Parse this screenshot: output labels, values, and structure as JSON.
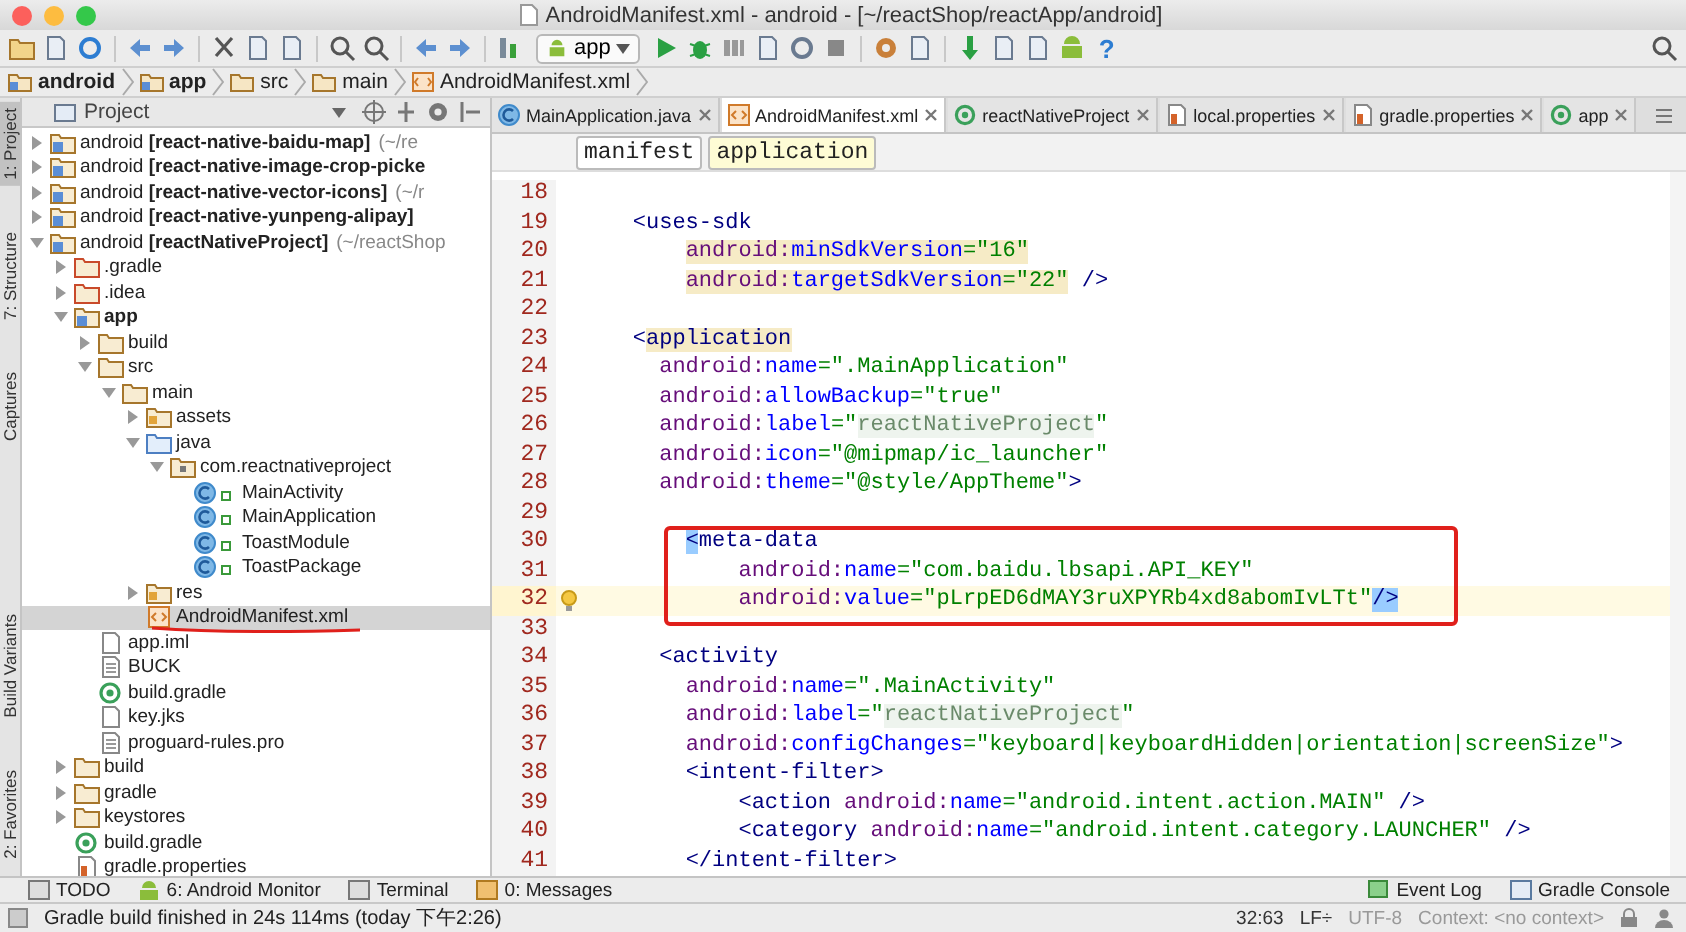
{
  "window": {
    "title": "AndroidManifest.xml - android - [~/reactShop/reactApp/android]"
  },
  "toolbar": {
    "run_config": "app",
    "help": "?"
  },
  "nav": [
    {
      "label": "android",
      "kind": "module"
    },
    {
      "label": "app",
      "kind": "module"
    },
    {
      "label": "src",
      "kind": "folder"
    },
    {
      "label": "main",
      "kind": "folder"
    },
    {
      "label": "AndroidManifest.xml",
      "kind": "manifest"
    }
  ],
  "left_strip": {
    "top": [
      {
        "label": "1: Project",
        "selected": true
      },
      {
        "label": "7: Structure",
        "selected": false
      },
      {
        "label": "Captures",
        "selected": false
      }
    ],
    "bottom": [
      {
        "label": "Build Variants",
        "selected": false
      },
      {
        "label": "2: Favorites",
        "selected": false
      }
    ]
  },
  "project": {
    "view": "Project",
    "tree": [
      {
        "label": "android **[react-native-baidu-map]**",
        "suffix": "(~/re",
        "kind": "module",
        "expanded": false,
        "selected": false,
        "underlined": false
      },
      {
        "label": "android **[react-native-image-crop-picke**",
        "kind": "module",
        "expanded": false,
        "selected": false,
        "underlined": false
      },
      {
        "label": "android **[react-native-vector-icons]**",
        "suffix": "(~/r",
        "kind": "module",
        "expanded": false,
        "selected": false,
        "underlined": false
      },
      {
        "label": "android **[react-native-yunpeng-alipay]**",
        "kind": "module",
        "expanded": false,
        "selected": false,
        "underlined": false
      },
      {
        "label": "android **[reactNativeProject]**",
        "suffix": "(~/reactShop",
        "kind": "module",
        "expanded": true,
        "selected": false,
        "underlined": false,
        "children": [
          {
            "label": ".gradle",
            "kind": "folder",
            "expanded": false,
            "selected": false,
            "underlined": false
          },
          {
            "label": ".idea",
            "kind": "folder",
            "expanded": false,
            "selected": false,
            "underlined": false
          },
          {
            "label": "**app**",
            "kind": "module",
            "expanded": true,
            "selected": false,
            "underlined": false,
            "children": [
              {
                "label": "build",
                "kind": "folder",
                "expanded": false,
                "selected": false,
                "underlined": false
              },
              {
                "label": "src",
                "kind": "folder",
                "expanded": true,
                "selected": false,
                "underlined": false,
                "children": [
                  {
                    "label": "main",
                    "kind": "folder",
                    "expanded": true,
                    "selected": false,
                    "underlined": false,
                    "children": [
                      {
                        "label": "assets",
                        "kind": "resfolder",
                        "expanded": false,
                        "selected": false,
                        "underlined": false
                      },
                      {
                        "label": "java",
                        "kind": "source",
                        "expanded": true,
                        "selected": false,
                        "underlined": false,
                        "children": [
                          {
                            "label": "com.reactnativeproject",
                            "kind": "package",
                            "expanded": true,
                            "selected": false,
                            "underlined": false,
                            "children": [
                              {
                                "label": "MainActivity",
                                "kind": "class",
                                "selected": false,
                                "underlined": false
                              },
                              {
                                "label": "MainApplication",
                                "kind": "class",
                                "selected": false,
                                "underlined": false
                              },
                              {
                                "label": "ToastModule",
                                "kind": "class",
                                "selected": false,
                                "underlined": false
                              },
                              {
                                "label": "ToastPackage",
                                "kind": "class",
                                "selected": false,
                                "underlined": false
                              }
                            ]
                          }
                        ]
                      },
                      {
                        "label": "res",
                        "kind": "resfolder",
                        "expanded": false,
                        "selected": false,
                        "underlined": false
                      },
                      {
                        "label": "AndroidManifest.xml",
                        "kind": "manifest",
                        "selected": true,
                        "underlined": true
                      }
                    ]
                  }
                ]
              },
              {
                "label": "app.iml",
                "kind": "file",
                "selected": false,
                "underlined": false
              },
              {
                "label": "BUCK",
                "kind": "text",
                "selected": false,
                "underlined": false
              },
              {
                "label": "build.gradle",
                "kind": "gradle",
                "selected": false,
                "underlined": false
              },
              {
                "label": "key.jks",
                "kind": "file",
                "selected": false,
                "underlined": false
              },
              {
                "label": "proguard-rules.pro",
                "kind": "text",
                "selected": false,
                "underlined": false
              }
            ]
          },
          {
            "label": "build",
            "kind": "folder",
            "expanded": false,
            "selected": false,
            "underlined": false
          },
          {
            "label": "gradle",
            "kind": "folder",
            "expanded": false,
            "selected": false,
            "underlined": false
          },
          {
            "label": "keystores",
            "kind": "folder",
            "expanded": false,
            "selected": false,
            "underlined": false
          },
          {
            "label": "build.gradle",
            "kind": "gradle",
            "selected": false,
            "underlined": false
          },
          {
            "label": "gradle.properties",
            "kind": "properties",
            "selected": false,
            "underlined": false
          }
        ]
      }
    ]
  },
  "tabs": [
    {
      "label": "MainApplication.java",
      "kind": "class",
      "selected": false
    },
    {
      "label": "AndroidManifest.xml",
      "kind": "manifest",
      "selected": true
    },
    {
      "label": "reactNativeProject",
      "kind": "gradle",
      "selected": false
    },
    {
      "label": "local.properties",
      "kind": "properties",
      "selected": false
    },
    {
      "label": "gradle.properties",
      "kind": "properties",
      "selected": false
    },
    {
      "label": "app",
      "kind": "gradle",
      "selected": false
    }
  ],
  "breadcrumb": [
    {
      "label": "manifest",
      "selected": false
    },
    {
      "label": "application",
      "selected": true
    }
  ],
  "code": {
    "lines": [
      {
        "n": "18",
        "current": false,
        "boxed": false
      },
      {
        "n": "19",
        "current": false,
        "boxed": false,
        "tokens": [
          {
            "kind": "tag",
            "text": "    <uses-sdk"
          }
        ]
      },
      {
        "n": "20",
        "current": false,
        "boxed": false,
        "tokens": [
          {
            "kind": "ns",
            "text": "        android:",
            "highlighted": true
          },
          {
            "kind": "attr",
            "text": "minSdkVersion",
            "highlighted": true
          },
          {
            "kind": "value",
            "text": "=\"16\"",
            "highlighted": true
          }
        ]
      },
      {
        "n": "21",
        "current": false,
        "boxed": false,
        "tokens": [
          {
            "kind": "ns",
            "text": "        android:",
            "highlighted": true
          },
          {
            "kind": "attr",
            "text": "targetSdkVersion",
            "highlighted": true
          },
          {
            "kind": "value",
            "text": "=\"22\"",
            "highlighted": true
          },
          {
            "kind": "tag",
            "text": " />",
            "highlighted": false
          }
        ]
      },
      {
        "n": "22",
        "current": false,
        "boxed": false
      },
      {
        "n": "23",
        "current": false,
        "boxed": false,
        "tokens": [
          {
            "kind": "tag",
            "text": "    <",
            "highlighted": false
          },
          {
            "kind": "tag",
            "text": "application",
            "highlighted": true
          }
        ]
      },
      {
        "n": "24",
        "current": false,
        "boxed": false,
        "tokens": [
          {
            "kind": "ns",
            "text": "      android:"
          },
          {
            "kind": "attr",
            "text": "name"
          },
          {
            "kind": "value",
            "text": "=\".MainApplication\""
          }
        ]
      },
      {
        "n": "25",
        "current": false,
        "boxed": false,
        "tokens": [
          {
            "kind": "ns",
            "text": "      android:"
          },
          {
            "kind": "attr",
            "text": "allowBackup"
          },
          {
            "kind": "value",
            "text": "=\"true\""
          }
        ]
      },
      {
        "n": "26",
        "current": false,
        "boxed": false,
        "tokens": [
          {
            "kind": "ns",
            "text": "      android:"
          },
          {
            "kind": "attr",
            "text": "label"
          },
          {
            "kind": "value",
            "text": "=\""
          },
          {
            "kind": "folded",
            "text": "reactNativeProject"
          },
          {
            "kind": "value",
            "text": "\""
          }
        ]
      },
      {
        "n": "27",
        "current": false,
        "boxed": false,
        "tokens": [
          {
            "kind": "ns",
            "text": "      android:"
          },
          {
            "kind": "attr",
            "text": "icon"
          },
          {
            "kind": "value",
            "text": "=\"@mipmap/ic_launcher\""
          }
        ]
      },
      {
        "n": "28",
        "current": false,
        "boxed": false,
        "tokens": [
          {
            "kind": "ns",
            "text": "      android:"
          },
          {
            "kind": "attr",
            "text": "theme"
          },
          {
            "kind": "value",
            "text": "=\"@style/AppTheme\""
          },
          {
            "kind": "tag",
            "text": ">"
          }
        ]
      },
      {
        "n": "29",
        "current": false,
        "boxed": false
      },
      {
        "n": "30",
        "current": false,
        "boxed": true,
        "tokens": [
          {
            "kind": "brace",
            "text": "        <"
          },
          {
            "kind": "tag",
            "text": "meta-data"
          }
        ]
      },
      {
        "n": "31",
        "current": false,
        "boxed": true,
        "tokens": [
          {
            "kind": "ns",
            "text": "            android:"
          },
          {
            "kind": "attr",
            "text": "name"
          },
          {
            "kind": "value",
            "text": "=\"com.baidu.lbsapi.API_KEY\""
          }
        ]
      },
      {
        "n": "32",
        "current": true,
        "boxed": true,
        "tokens": [
          {
            "kind": "ns",
            "text": "            android:"
          },
          {
            "kind": "attr",
            "text": "value"
          },
          {
            "kind": "value",
            "text": "=\"pLrpED6dMAY3ruXPYRb4xd8abomIvLTt\""
          },
          {
            "kind": "brace",
            "text": "/>"
          }
        ]
      },
      {
        "n": "33",
        "current": false,
        "boxed": false
      },
      {
        "n": "34",
        "current": false,
        "boxed": false,
        "tokens": [
          {
            "kind": "tag",
            "text": "      <activity"
          }
        ]
      },
      {
        "n": "35",
        "current": false,
        "boxed": false,
        "tokens": [
          {
            "kind": "ns",
            "text": "        android:"
          },
          {
            "kind": "attr",
            "text": "name"
          },
          {
            "kind": "value",
            "text": "=\".MainActivity\""
          }
        ]
      },
      {
        "n": "36",
        "current": false,
        "boxed": false,
        "tokens": [
          {
            "kind": "ns",
            "text": "        android:"
          },
          {
            "kind": "attr",
            "text": "label"
          },
          {
            "kind": "value",
            "text": "=\""
          },
          {
            "kind": "folded",
            "text": "reactNativeProject"
          },
          {
            "kind": "value",
            "text": "\""
          }
        ]
      },
      {
        "n": "37",
        "current": false,
        "boxed": false,
        "tokens": [
          {
            "kind": "ns",
            "text": "        android:"
          },
          {
            "kind": "attr",
            "text": "configChanges"
          },
          {
            "kind": "value",
            "text": "=\"keyboard|keyboardHidden|orientation|screenSize\""
          },
          {
            "kind": "tag",
            "text": ">"
          }
        ]
      },
      {
        "n": "38",
        "current": false,
        "boxed": false,
        "tokens": [
          {
            "kind": "tag",
            "text": "        <intent-filter>"
          }
        ]
      },
      {
        "n": "39",
        "current": false,
        "boxed": false,
        "tokens": [
          {
            "kind": "tag",
            "text": "            <action "
          },
          {
            "kind": "ns",
            "text": "android:"
          },
          {
            "kind": "attr",
            "text": "name"
          },
          {
            "kind": "value",
            "text": "=\"android.intent.action.MAIN\""
          },
          {
            "kind": "tag",
            "text": " />"
          }
        ]
      },
      {
        "n": "40",
        "current": false,
        "boxed": false,
        "tokens": [
          {
            "kind": "tag",
            "text": "            <category "
          },
          {
            "kind": "ns",
            "text": "android:"
          },
          {
            "kind": "attr",
            "text": "name"
          },
          {
            "kind": "value",
            "text": "=\"android.intent.category.LAUNCHER\""
          },
          {
            "kind": "tag",
            "text": " />"
          }
        ]
      },
      {
        "n": "41",
        "current": false,
        "boxed": false,
        "tokens": [
          {
            "kind": "tag",
            "text": "        </intent-filter>"
          }
        ]
      }
    ]
  },
  "tool_windows": {
    "left": [
      {
        "label": "TODO",
        "kind": "todo"
      },
      {
        "label": "6: Android Monitor",
        "kind": "android"
      },
      {
        "label": "Terminal",
        "kind": "terminal"
      },
      {
        "label": "0: Messages",
        "kind": "messages"
      }
    ],
    "right": [
      {
        "label": "Event Log",
        "kind": "log"
      },
      {
        "label": "Gradle Console",
        "kind": "console"
      }
    ]
  },
  "status_bar": {
    "message": "Gradle build finished in 24s 114ms (today 下午2:26)",
    "items": [
      {
        "text": "32:63",
        "disabled": false
      },
      {
        "text": "LF÷",
        "disabled": false
      },
      {
        "text": "UTF-8",
        "disabled": true
      },
      {
        "text": "Context: <no context>",
        "disabled": true
      }
    ]
  }
}
